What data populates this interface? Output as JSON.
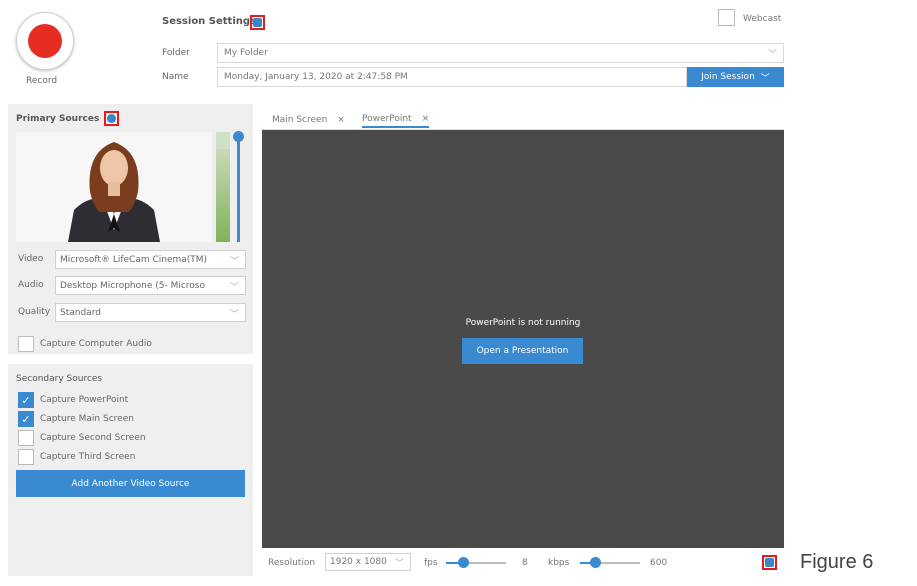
{
  "record": {
    "label": "Record"
  },
  "session": {
    "title": "Session Settings",
    "folder_label": "Folder",
    "folder_value": "My Folder",
    "name_label": "Name",
    "name_value": "Monday, January 13, 2020 at 2:47:58 PM",
    "join_label": "Join Session",
    "webcast_label": "Webcast"
  },
  "primary": {
    "title": "Primary Sources",
    "video_label": "Video",
    "video_value": "Microsoft® LifeCam Cinema(TM)",
    "audio_label": "Audio",
    "audio_value": "Desktop Microphone (5- Microso",
    "quality_label": "Quality",
    "quality_value": "Standard",
    "capture_audio_label": "Capture Computer Audio",
    "audio_level": 0.85
  },
  "secondary": {
    "title": "Secondary Sources",
    "items": [
      {
        "label": "Capture PowerPoint",
        "checked": true
      },
      {
        "label": "Capture Main Screen",
        "checked": true
      },
      {
        "label": "Capture Second Screen",
        "checked": false
      },
      {
        "label": "Capture Third Screen",
        "checked": false
      }
    ],
    "add_label": "Add Another Video Source"
  },
  "tabs": [
    {
      "label": "Main Screen",
      "close": "×"
    },
    {
      "label": "PowerPoint",
      "close": "×"
    }
  ],
  "main": {
    "status": "PowerPoint is not running",
    "open_label": "Open a Presentation"
  },
  "bottom": {
    "resolution_label": "Resolution",
    "resolution_value": "1920 x 1080",
    "fps_label": "fps",
    "fps_value": "8",
    "kbps_label": "kbps",
    "kbps_value": "600"
  },
  "figure_label": "Figure 6",
  "colors": {
    "accent": "#3a8ad1",
    "record": "#e52d20",
    "highlight": "#e01e1e",
    "canvas": "#4a4a4a"
  }
}
